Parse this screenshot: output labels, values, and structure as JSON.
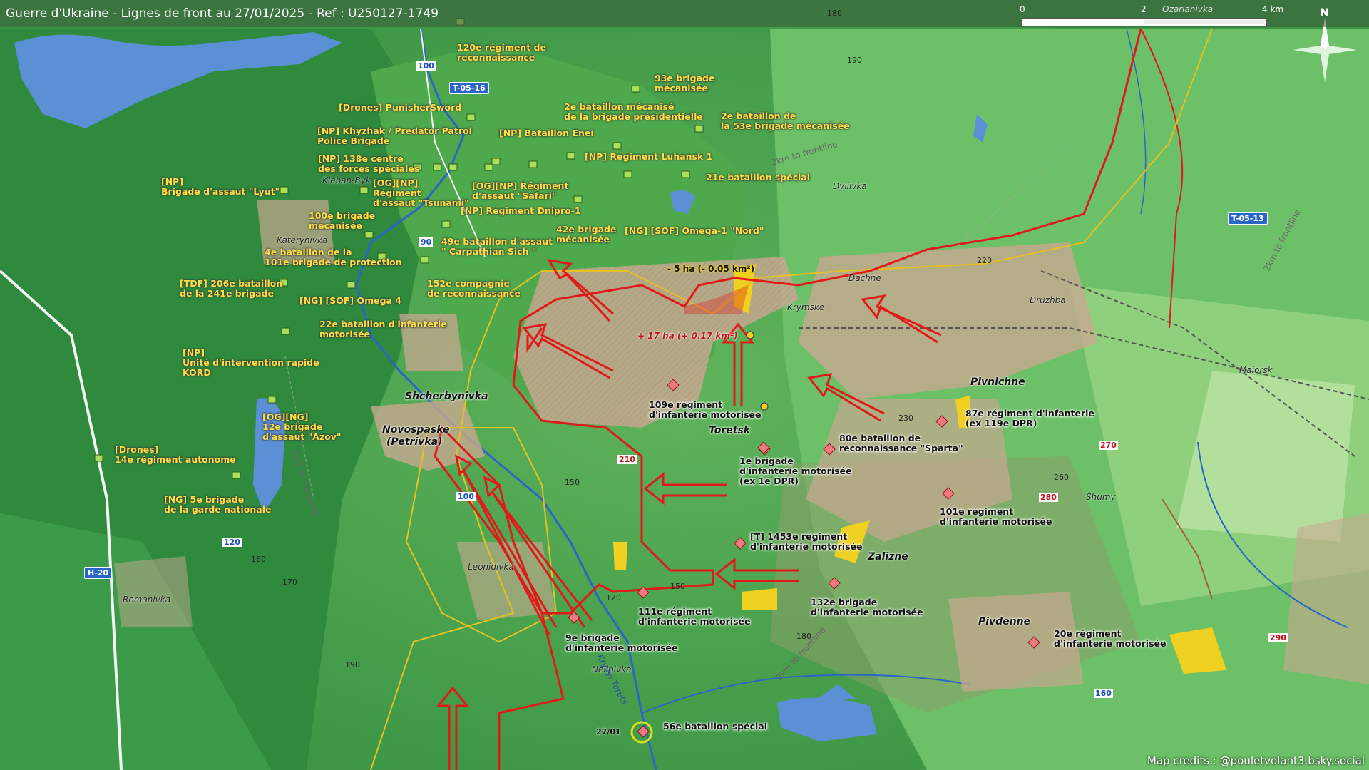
{
  "title": "Guerre d'Ukraine - Lignes de front au 27/01/2025 - Ref : U250127-1749",
  "scale": {
    "t0": "0",
    "t2": "2",
    "t4": "4 km",
    "place": "Ozarianivka"
  },
  "north": "N",
  "credits": "Map credits : @pouletvolant3.bsky.social",
  "date_marker": "27/01",
  "river_name": "Kryvyi Torets",
  "frontline_labels": [
    "2km to frontline",
    "2km to frontline",
    "2km to frontline",
    "2km to frontline"
  ],
  "area_labels": {
    "loss": "- 5 ha (- 0.05 km²)",
    "gain": "+ 17 ha (+ 0.17 km²)"
  },
  "roads": {
    "t0516": "T-05-16",
    "t0513": "T-05-13",
    "h20": "H-20",
    "r100a": "100",
    "r90": "90",
    "r100b": "100",
    "r120": "120",
    "r210": "210",
    "r160": "160",
    "r270": "270",
    "r280": "280",
    "r290": "290"
  },
  "towns": {
    "toretsk": "Toretsk",
    "shcherbynivka": "Shcherbynivka",
    "novospaske": "Novospaske",
    "petrivka": "(Petrivka)",
    "pivnichne": "Pivnichne",
    "zalizne": "Zalizne",
    "pivdenne": "Pivdenne"
  },
  "villages": {
    "dyliivka": "Dyliivka",
    "dachne": "Dachne",
    "krymske": "Krymske",
    "druzhba": "Druzhba",
    "maiorsk": "Maiorsk",
    "shumy": "Shumy",
    "kleban": "Kleban-Byk",
    "katerynivka": "Katerynivka",
    "leonidivka": "Leonidivka",
    "nelipivka": "Nelipivka",
    "romanivka": "Romanivka"
  },
  "elevations": [
    "180",
    "190",
    "220",
    "230",
    "260",
    "150",
    "150",
    "160",
    "170",
    "190",
    "180",
    "120"
  ],
  "ua_units": [
    "120e régiment de",
    "reconnaissance",
    "93e brigade",
    "mécanisée",
    "[Drones] PunisherSword",
    "2e bataillon mécanisé",
    "de la brigade présidentielle",
    "2e bataillon de",
    "la 53e brigade mécanisée",
    "[NP] Khyzhak / Predator Patrol",
    "Police Brigade",
    "[NP] Bataillon Enei",
    "[NP] 138e centre",
    "des forces spéciales",
    "[NP] Régiment Luhansk 1",
    "[NP]",
    "Brigade d'assaut \"Lyut\"",
    "[OG][NP]",
    "Régiment",
    "d'assaut \"Tsunami\"",
    "[OG][NP] Régiment",
    "d'assaut \"Safari\"",
    "21e bataillon spécial",
    "[NP] Régiment Dnipro-1",
    "100e brigade",
    "mécanisée",
    "42e brigade",
    "mécanisée",
    "[NG] [SOF] Omega-1 \"Nord\"",
    "49e bataillon d'assaut",
    "\" Carpathian Sich \"",
    "4e bataillon de la",
    "101e brigade de protection",
    "[TDF] 206e bataillon",
    "de la 241e brigade",
    "152e compagnie",
    "de reconnaissance",
    "[NG] [SOF] Omega 4",
    "22e bataillon d'infanterie",
    "motorisée",
    "[NP]",
    "Unité d'intervention rapide",
    "KORD",
    "[OG][NG]",
    "12e brigade",
    "d'assaut \"Azov\"",
    "[Drones]",
    "14e régiment autonome",
    "[NG] 5e brigade",
    "de la garde nationale"
  ],
  "ru_units": [
    "109e régiment",
    "d'infanterie motorisée",
    "80e bataillon de",
    "reconnaissance \"Sparta\"",
    "87e régiment d'infanterie",
    "(ex 119e DPR)",
    "1e brigade",
    "d'infanterie motorisée",
    "(ex 1e DPR)",
    "101e régiment",
    "d'infanterie motorisée",
    "[T] 1453e régiment",
    "d'infanterie motorisée",
    "132e brigade",
    "d'infanterie motorisée",
    "111e régiment",
    "d'infanterie motorisée",
    "9e brigade",
    "d'infanterie motorisée",
    "20e régiment",
    "d'infanterie motorisée",
    "56e bataillon spécial"
  ],
  "colors": {
    "ua_unit": "#a8e05a",
    "ru_unit": "#f07a80",
    "front_red": "#e01a1a",
    "yellow_line": "#e8c020",
    "water": "#5b8fd6"
  }
}
